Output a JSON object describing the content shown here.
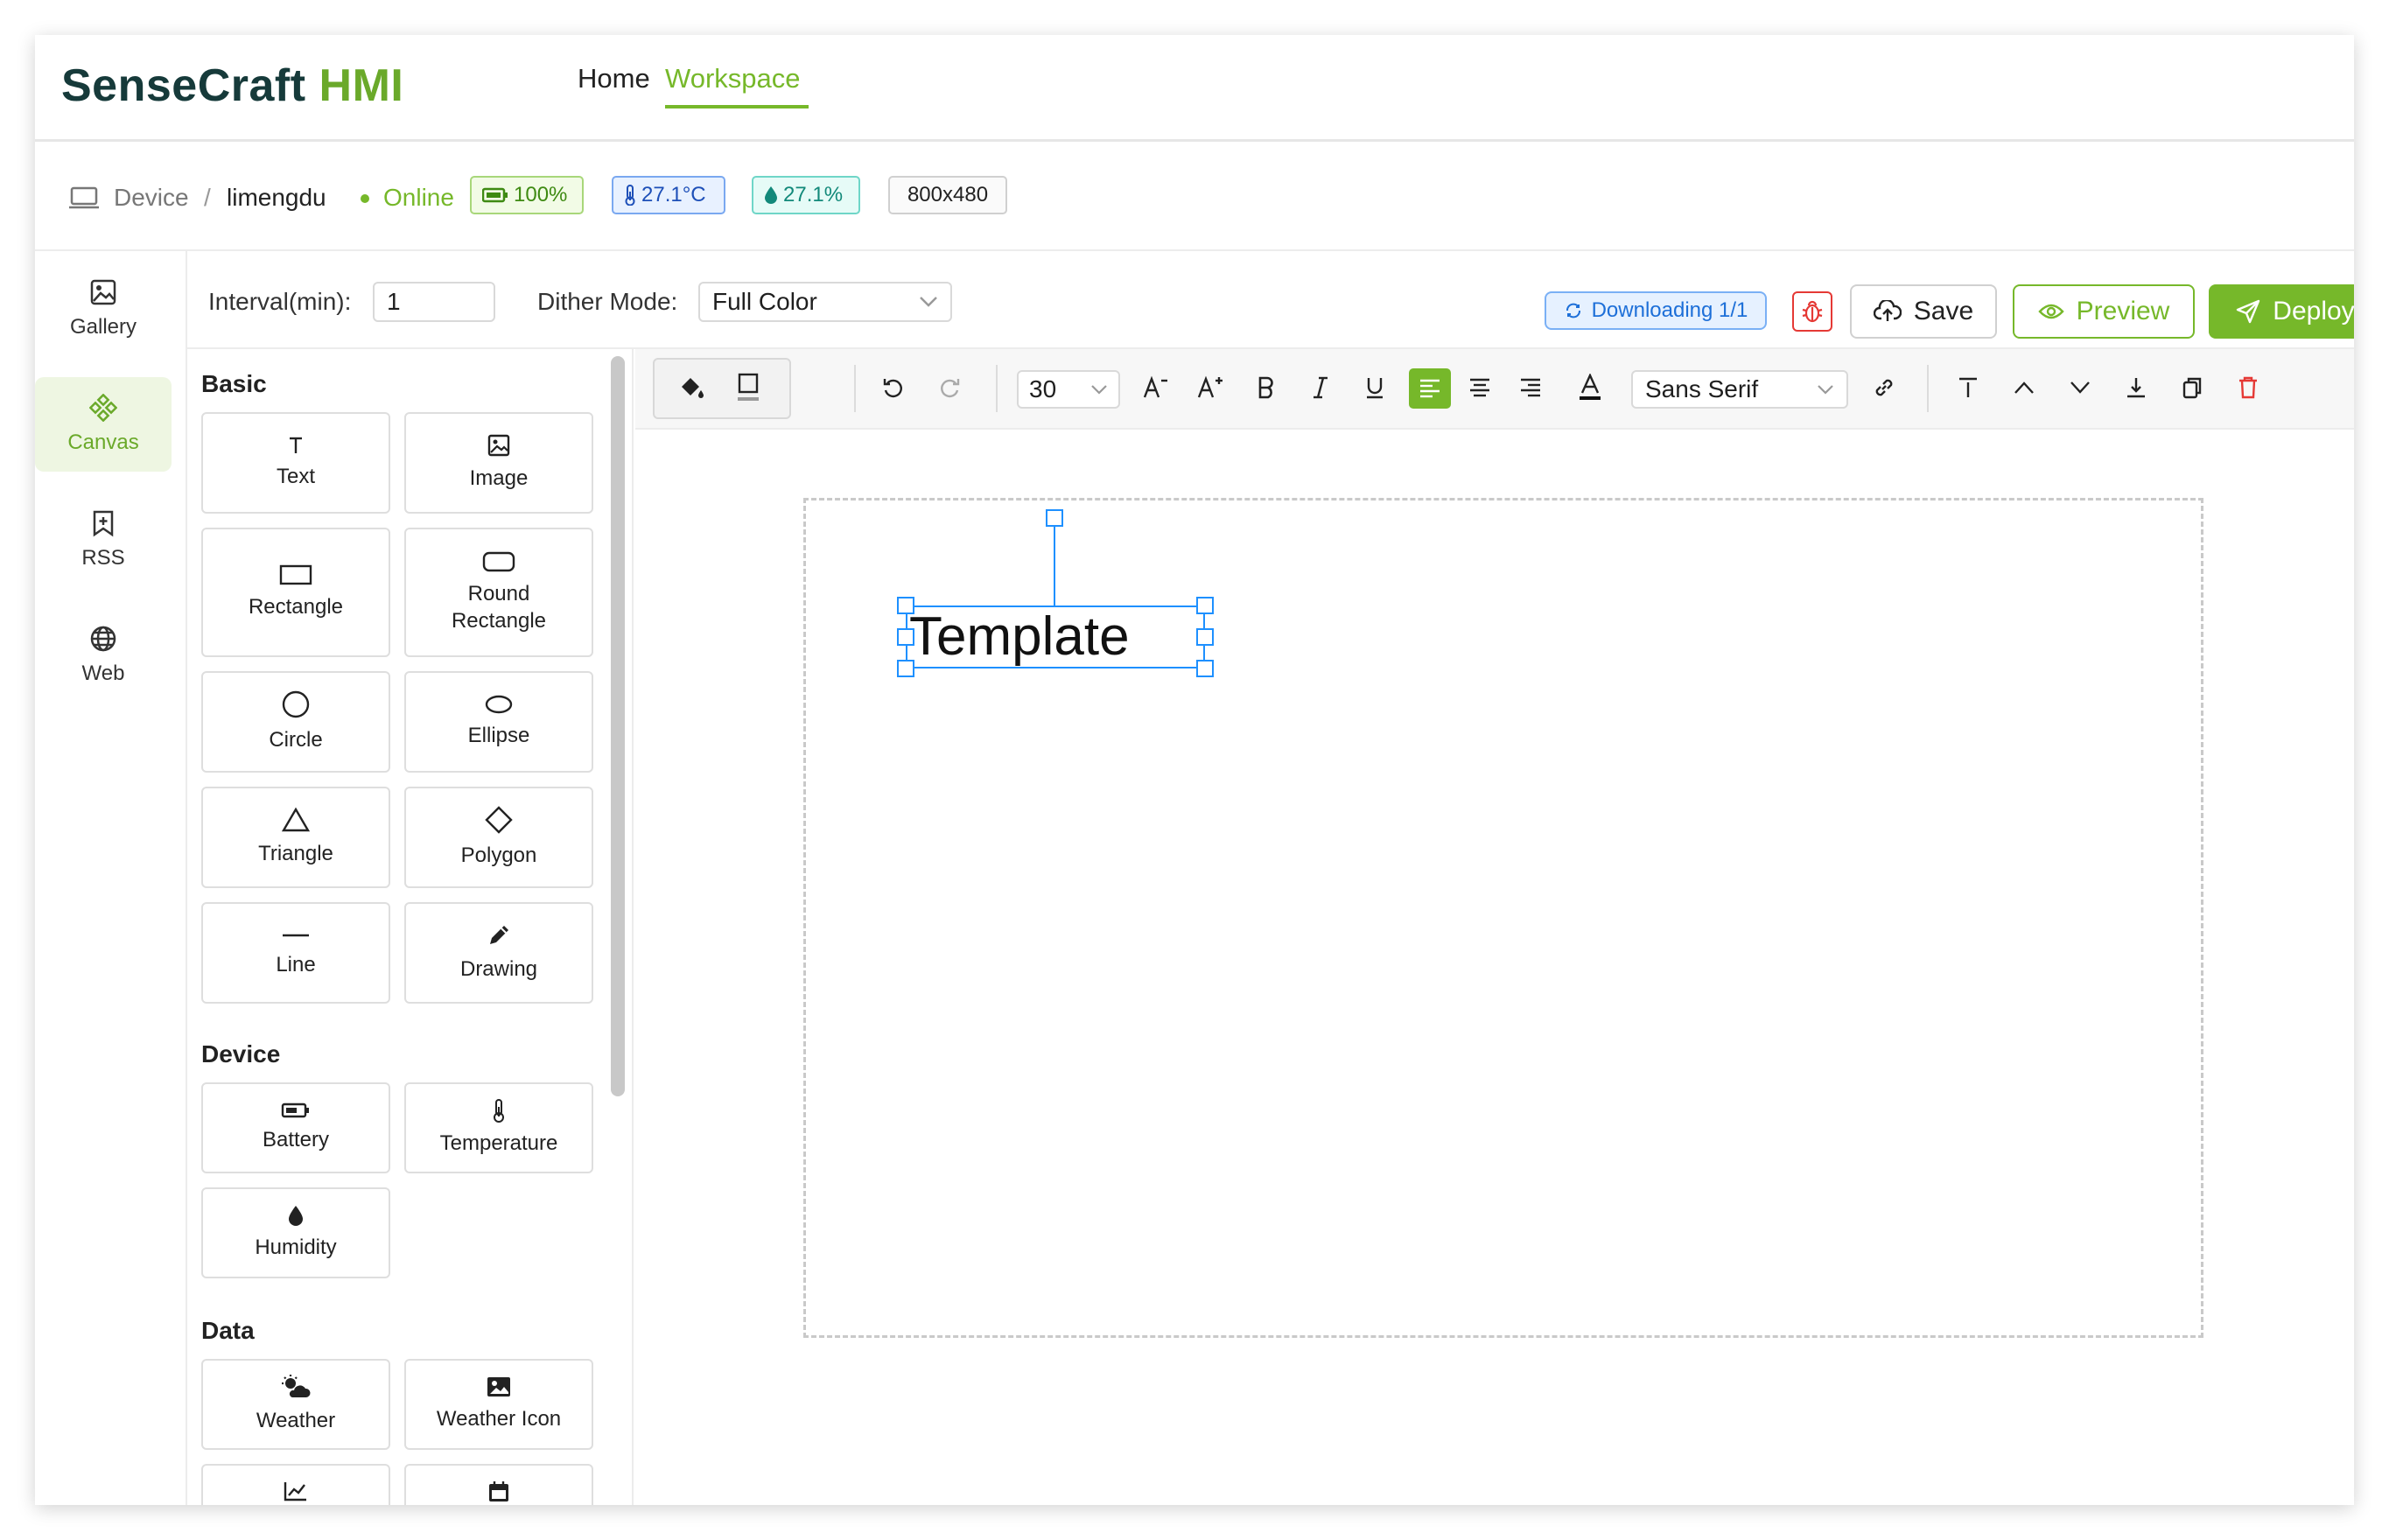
{
  "header": {
    "logo_part1": "SenseCraft",
    "logo_part2": "HMI",
    "nav": [
      "Home",
      "Workspace"
    ],
    "active_nav": "Workspace"
  },
  "device_bar": {
    "breadcrumb_root": "Device",
    "separator": "/",
    "device_name": "limengdu",
    "status": "Online",
    "battery": "100%",
    "temperature": "27.1°C",
    "humidity": "27.1%",
    "resolution": "800x480"
  },
  "sidebar": {
    "items": [
      {
        "label": "Gallery",
        "icon": "image-icon"
      },
      {
        "label": "Canvas",
        "icon": "canvas-icon",
        "active": true
      },
      {
        "label": "RSS",
        "icon": "bookmark-plus-icon"
      },
      {
        "label": "Web",
        "icon": "globe-icon"
      }
    ]
  },
  "toolbar": {
    "interval_label": "Interval(min):",
    "interval_value": "1",
    "dither_label": "Dither Mode:",
    "dither_value": "Full Color",
    "downloading": "Downloading 1/1",
    "save_label": "Save",
    "preview_label": "Preview",
    "deploy_label": "Deploy"
  },
  "palette": {
    "sections": [
      {
        "title": "Basic",
        "items": [
          "Text",
          "Image",
          "Rectangle",
          "Round Rectangle",
          "Circle",
          "Ellipse",
          "Triangle",
          "Polygon",
          "Line",
          "Drawing"
        ]
      },
      {
        "title": "Device",
        "items": [
          "Battery",
          "Temperature",
          "Humidity"
        ]
      },
      {
        "title": "Data",
        "items": [
          "Weather",
          "Weather Icon"
        ]
      }
    ]
  },
  "editor": {
    "font_size": "30",
    "font_family": "Sans Serif",
    "active_align": "left"
  },
  "canvas": {
    "element_text": "Template"
  },
  "colors": {
    "accent": "#76b82a",
    "selection": "#1e90ff",
    "danger": "#e53935"
  }
}
